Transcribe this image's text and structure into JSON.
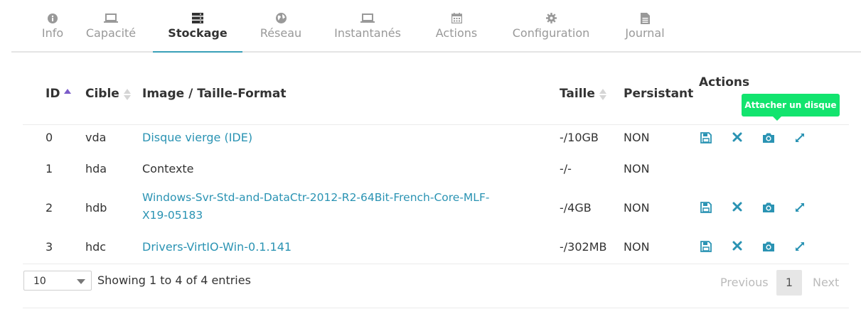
{
  "tabs": [
    {
      "label": "Info",
      "icon": "info-circle-icon"
    },
    {
      "label": "Capacité",
      "icon": "laptop-icon"
    },
    {
      "label": "Stockage",
      "icon": "server-icon",
      "active": true
    },
    {
      "label": "Réseau",
      "icon": "globe-icon"
    },
    {
      "label": "Instantanés",
      "icon": "laptop-icon"
    },
    {
      "label": "Actions",
      "icon": "calendar-icon"
    },
    {
      "label": "Configuration",
      "icon": "gear-icon"
    },
    {
      "label": "Journal",
      "icon": "file-icon"
    }
  ],
  "table": {
    "headers": {
      "id": "ID",
      "cible": "Cible",
      "image": "Image / Taille-Format",
      "taille": "Taille",
      "persistant": "Persistant",
      "actions": "Actions"
    },
    "rows": [
      {
        "id": "0",
        "cible": "vda",
        "image": "Disque vierge (IDE)",
        "image_line2": "",
        "taille": "-/10GB",
        "persistant": "NON",
        "has_actions": true
      },
      {
        "id": "1",
        "cible": "hda",
        "image": "Contexte",
        "image_line2": "",
        "taille": "-/-",
        "persistant": "NON",
        "has_actions": false
      },
      {
        "id": "2",
        "cible": "hdb",
        "image": "Windows-Svr-Std-and-DataCtr-2012-R2-64Bit-French-Core-MLF-",
        "image_line2": "X19-05183",
        "taille": "-/4GB",
        "persistant": "NON",
        "has_actions": true
      },
      {
        "id": "3",
        "cible": "hdc",
        "image": "Drivers-VirtIO-Win-0.1.141",
        "image_line2": "",
        "taille": "-/302MB",
        "persistant": "NON",
        "has_actions": true
      }
    ]
  },
  "tooltip": "Attacher un disque",
  "footer": {
    "page_length": "10",
    "info": "Showing 1 to 4 of 4 entries",
    "previous": "Previous",
    "page": "1",
    "next": "Next"
  },
  "colors": {
    "link": "#2a93b3",
    "active_tab_underline": "#39a0b8",
    "tooltip_bg": "#12e46e",
    "sort_active": "#7b5cc9"
  }
}
